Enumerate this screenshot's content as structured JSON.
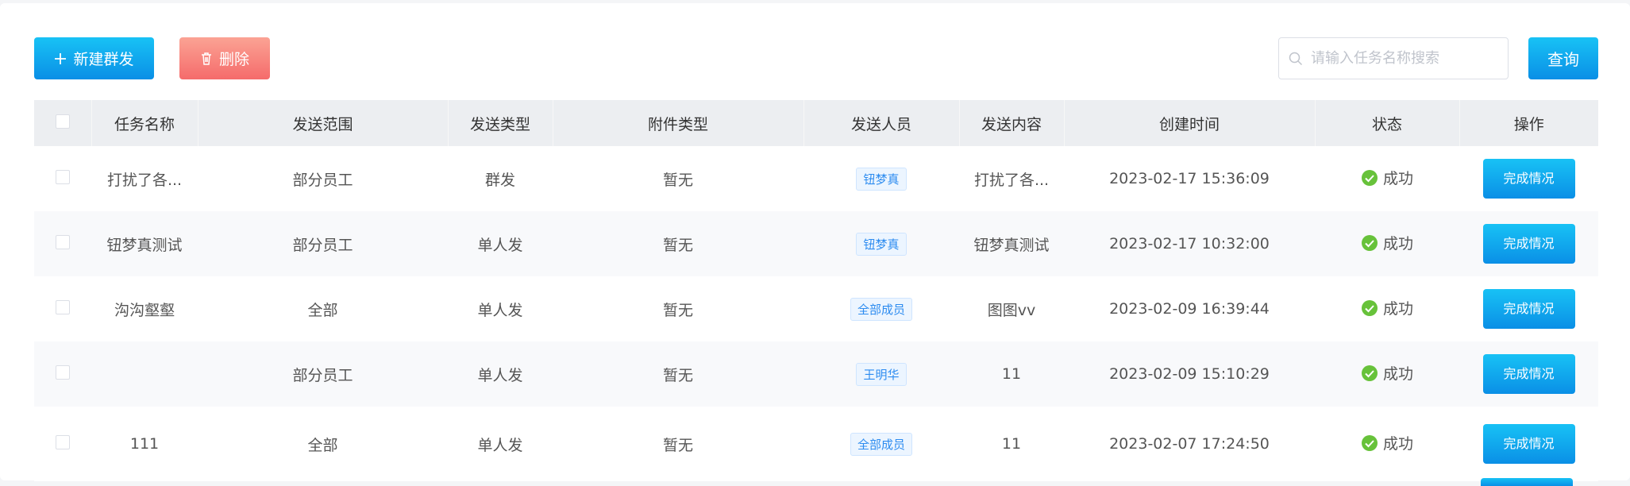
{
  "toolbar": {
    "new_label": "新建群发",
    "delete_label": "删除",
    "search_placeholder": "请输入任务名称搜索",
    "query_label": "查询"
  },
  "table": {
    "headers": [
      "任务名称",
      "发送范围",
      "发送类型",
      "附件类型",
      "发送人员",
      "发送内容",
      "创建时间",
      "状态",
      "操作"
    ],
    "rows": [
      {
        "name": "打扰了各...",
        "scope": "部分员工",
        "type": "群发",
        "attachment": "暂无",
        "sender": "钮梦真",
        "content": "打扰了各...",
        "created": "2023-02-17 15:36:09",
        "status": "成功",
        "action": "完成情况"
      },
      {
        "name": "钮梦真测试",
        "scope": "部分员工",
        "type": "单人发",
        "attachment": "暂无",
        "sender": "钮梦真",
        "content": "钮梦真测试",
        "created": "2023-02-17 10:32:00",
        "status": "成功",
        "action": "完成情况"
      },
      {
        "name": "沟沟壑壑",
        "scope": "全部",
        "type": "单人发",
        "attachment": "暂无",
        "sender": "全部成员",
        "content": "图图vv",
        "created": "2023-02-09 16:39:44",
        "status": "成功",
        "action": "完成情况"
      },
      {
        "name": "",
        "scope": "部分员工",
        "type": "单人发",
        "attachment": "暂无",
        "sender": "王明华",
        "content": "11",
        "created": "2023-02-09 15:10:29",
        "status": "成功",
        "action": "完成情况"
      },
      {
        "name": "111",
        "scope": "全部",
        "type": "单人发",
        "attachment": "暂无",
        "sender": "全部成员",
        "content": "11",
        "created": "2023-02-07 17:24:50",
        "status": "成功",
        "action": "完成情况"
      }
    ]
  },
  "colors": {
    "primary": "#0a8fe6",
    "danger": "#f56b6b",
    "success": "#67c23a",
    "header_bg": "#eceef1"
  },
  "icons": {
    "new": "plus-icon",
    "delete": "trash-icon",
    "search": "search-icon",
    "status": "check-circle-icon"
  }
}
